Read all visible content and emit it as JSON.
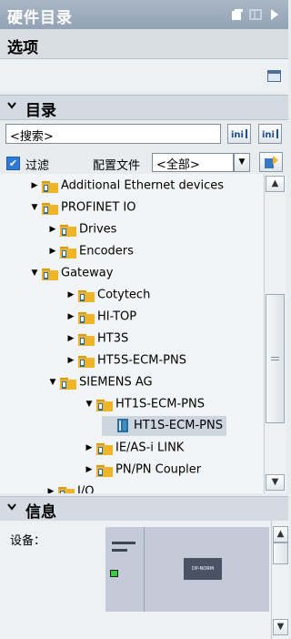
{
  "window": {
    "title": "硬件目录"
  },
  "options": {
    "title": "选项"
  },
  "catalog": {
    "title": "目录",
    "search_placeholder": "<搜索>",
    "filter_label": "过滤",
    "profile_label": "配置文件",
    "profile_value": "<全部>"
  },
  "tree": [
    {
      "label": "Additional Ethernet devices",
      "level": 1,
      "expanded": false
    },
    {
      "label": "PROFINET IO",
      "level": 0,
      "expanded": true
    },
    {
      "label": "Drives",
      "level": 2,
      "expanded": false
    },
    {
      "label": "Encoders",
      "level": 2,
      "expanded": false
    },
    {
      "label": "Gateway",
      "level": 1,
      "expanded": true
    },
    {
      "label": "Cotytech",
      "level": 3,
      "expanded": false
    },
    {
      "label": "HI-TOP",
      "level": 3,
      "expanded": false
    },
    {
      "label": "HT3S",
      "level": 3,
      "expanded": false
    },
    {
      "label": "HT5S-ECM-PNS",
      "level": 3,
      "expanded": false
    },
    {
      "label": "SIEMENS AG",
      "level": 2,
      "expanded": true
    },
    {
      "label": "HT1S-ECM-PNS",
      "level": 4,
      "expanded": true
    },
    {
      "label": "HT1S-ECM-PNS",
      "level": 5,
      "expanded": null,
      "selected": true
    },
    {
      "label": "IE/AS-i LINK",
      "level": 4,
      "expanded": false
    },
    {
      "label": "PN/PN Coupler",
      "level": 4,
      "expanded": false
    },
    {
      "label": "I/O",
      "level": 0,
      "expanded": false
    }
  ],
  "info": {
    "title": "信息",
    "device_label": "设备：",
    "module_text": "DP-NORM"
  },
  "colors": {
    "folder": "#f0b429",
    "accent": "#2d7bd6"
  }
}
